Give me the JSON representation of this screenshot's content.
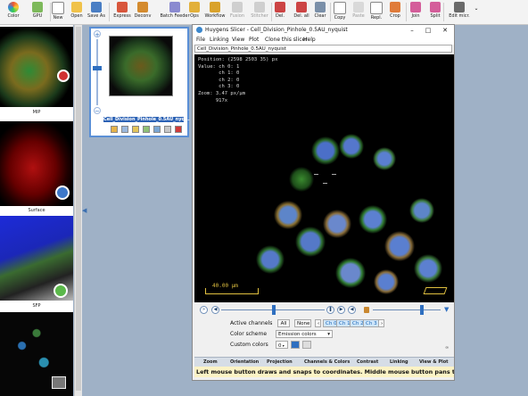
{
  "toolbar": {
    "items": [
      "Color",
      "GPU",
      "New",
      "Open",
      "Save As",
      "Express",
      "Deconv",
      "Batch Feeder",
      "Ops",
      "Workflow",
      "Fusion",
      "Stitcher",
      "Del.",
      "Del. all",
      "Clear",
      "Copy",
      "Paste",
      "Repl.",
      "Crop",
      "Join",
      "Split",
      "Edit micr."
    ]
  },
  "thumbs": {
    "labels": [
      "MIP",
      "Surface",
      "SFP"
    ]
  },
  "card": {
    "name": "Cell_Division_Pinhole_0.5AU_nyq..."
  },
  "slicer": {
    "title": "Huygens Slicer - Cell_Division_Pinhole_0.5AU_nyquist",
    "menus": [
      "File",
      "Linking",
      "View",
      "Plot",
      "Clone this slicer",
      "Help"
    ],
    "path": "Cell_Division_Pinhole_0.5AU_nyquist",
    "readout": "Position: (2598 2503 35) px\nValue: ch 0: 1\n       ch 1: 0\n       ch 2: 0\n       ch 3: 0\nZoom: 3.47 px/µm\n      917x",
    "scale_label": "40.00 µm",
    "active_channels_label": "Active channels",
    "btn_all": "All",
    "btn_none": "None",
    "channels": [
      "Ch 0",
      "Ch 1",
      "Ch 2",
      "Ch 3"
    ],
    "color_scheme_label": "Color scheme",
    "color_scheme_value": "Emission colors",
    "custom_colors_label": "Custom colors",
    "custom_value": "0",
    "tabs": [
      "Zoom",
      "Orientation",
      "Projection",
      "Channels & Colors",
      "Contrast",
      "Linking",
      "View & Plot"
    ],
    "status": "Left mouse button draws and snaps to coordinates. Middle mouse button pans the"
  }
}
